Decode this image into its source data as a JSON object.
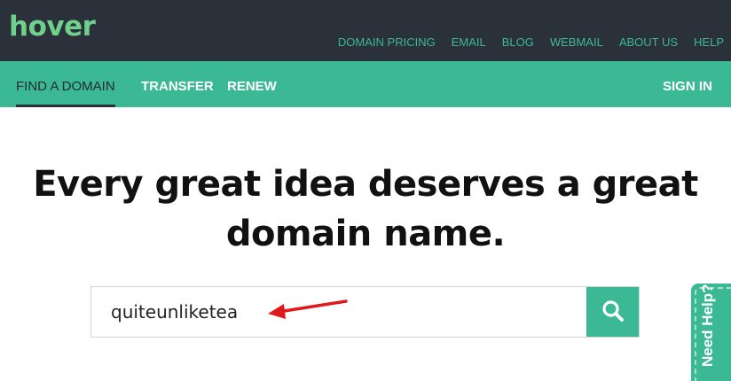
{
  "header": {
    "logo": "hover",
    "links": [
      {
        "label": "DOMAIN PRICING"
      },
      {
        "label": "EMAIL"
      },
      {
        "label": "BLOG"
      },
      {
        "label": "WEBMAIL"
      },
      {
        "label": "ABOUT US"
      },
      {
        "label": "HELP"
      }
    ]
  },
  "nav": {
    "find_domain": "FIND A DOMAIN",
    "transfer": "TRANSFER",
    "renew": "RENEW",
    "sign_in": "SIGN IN"
  },
  "main": {
    "headline_line1": "Every great idea deserves a great",
    "headline_line2": "domain name.",
    "search": {
      "value": "quiteunliketea",
      "button_icon": "search-icon"
    }
  },
  "help_tab": {
    "label": "Need Help?"
  },
  "colors": {
    "topbar": "#2b313a",
    "accent": "#3bb894",
    "logo": "#6fd08c",
    "annotation_arrow": "#e0181b"
  }
}
